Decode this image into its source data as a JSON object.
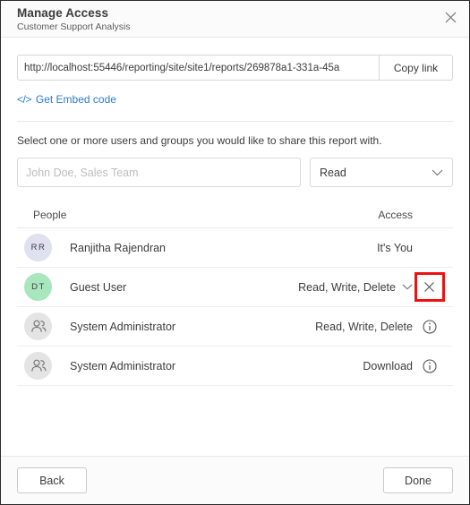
{
  "header": {
    "title": "Manage Access",
    "subtitle": "Customer Support Analysis",
    "close_icon": "close-icon"
  },
  "link_section": {
    "url_value": "http://localhost:55446/reporting/site/site1/reports/269878a1-331a-45a",
    "url_placeholder": "",
    "copy_label": "Copy link",
    "embed_glyph": "</>",
    "embed_label": "Get Embed code",
    "embed_color": "#2b7cd3"
  },
  "share": {
    "instruction": "Select one or more users and groups you would like to share this report with.",
    "people_placeholder": "John Doe, Sales Team",
    "people_value": "",
    "permission_selected": "Read",
    "permission_options": [
      "Read"
    ]
  },
  "table": {
    "columns": [
      "People",
      "Access"
    ],
    "rows": [
      {
        "avatar_type": "initials",
        "initials": "RR",
        "avatar_color": "#dfe0f0",
        "name": "Ranjitha Rajendran",
        "access": "It's You",
        "has_dropdown": false,
        "trailing": "none"
      },
      {
        "avatar_type": "initials",
        "initials": "DT",
        "avatar_color": "#a8e6bd",
        "name": "Guest User",
        "access": "Read, Write, Delete",
        "has_dropdown": true,
        "trailing": "remove"
      },
      {
        "avatar_type": "group",
        "initials": "",
        "avatar_color": "#e4e4e4",
        "name": "System Administrator",
        "access": "Read, Write, Delete",
        "has_dropdown": false,
        "trailing": "info"
      },
      {
        "avatar_type": "group",
        "initials": "",
        "avatar_color": "#e4e4e4",
        "name": "System Administrator",
        "access": "Download",
        "has_dropdown": false,
        "trailing": "info"
      }
    ]
  },
  "highlight": {
    "color": "#ee1111",
    "target_row_index": 1
  },
  "footer": {
    "back_label": "Back",
    "done_label": "Done"
  }
}
